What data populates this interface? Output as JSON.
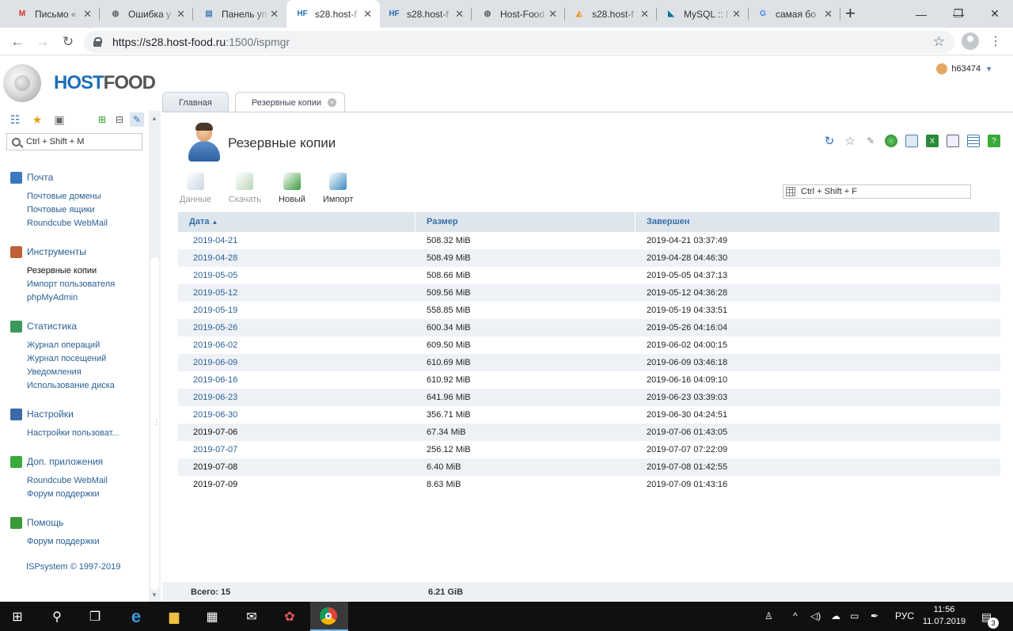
{
  "browser": {
    "tabs": [
      {
        "title": "Письмо «",
        "favicon": "gmail-icon",
        "color": "#d93025",
        "glyph": "M"
      },
      {
        "title": "Ошибка у",
        "favicon": "globe-icon",
        "color": "#5f6368",
        "glyph": "◍"
      },
      {
        "title": "Панель уп",
        "favicon": "document-icon",
        "color": "#4a7fb5",
        "glyph": "▤"
      },
      {
        "title": "s28.host-f",
        "favicon": "hostfood-icon",
        "color": "#1d6fb8",
        "glyph": "HF",
        "active": true
      },
      {
        "title": "s28.host-f",
        "favicon": "hostfood-icon",
        "color": "#1d6fb8",
        "glyph": "HF"
      },
      {
        "title": "Host-Food",
        "favicon": "globe-icon",
        "color": "#5f6368",
        "glyph": "◍"
      },
      {
        "title": "s28.host-f",
        "favicon": "phpmyadmin-icon",
        "color": "#f29111",
        "glyph": "◭"
      },
      {
        "title": "MySQL :: I",
        "favicon": "mysql-icon",
        "color": "#00758f",
        "glyph": "◣"
      },
      {
        "title": "самая бо",
        "favicon": "google-icon",
        "color": "#4285f4",
        "glyph": "G"
      }
    ],
    "url_host": "https://s28.host-food.ru",
    "url_path": ":1500/ispmgr"
  },
  "app": {
    "logo_a": "HOST",
    "logo_b": "FOOD",
    "user": "h63474",
    "tabs": [
      {
        "label": "Главная"
      },
      {
        "label": "Резервные копии"
      }
    ]
  },
  "sidebar": {
    "search_placeholder": "Ctrl + Shift + M",
    "sections": [
      {
        "title": "Почта",
        "icon_color": "#3a78c0",
        "items": [
          "Почтовые домены",
          "Почтовые ящики",
          "Roundcube WebMail"
        ]
      },
      {
        "title": "Инструменты",
        "icon_color": "#c0603a",
        "items": [
          "Резервные копии",
          "Импорт пользователя",
          "phpMyAdmin"
        ]
      },
      {
        "title": "Статистика",
        "icon_color": "#3a9a5a",
        "items": [
          "Журнал операций",
          "Журнал посещений",
          "Уведомления",
          "Использование диска"
        ]
      },
      {
        "title": "Настройки",
        "icon_color": "#3a6aa8",
        "items": [
          "Настройки пользоват..."
        ]
      },
      {
        "title": "Доп. приложения",
        "icon_color": "#3aaa3a",
        "items": [
          "Roundcube WebMail",
          "Форум поддержки"
        ]
      },
      {
        "title": "Помощь",
        "icon_color": "#3a9a3a",
        "items": [
          "Форум поддержки"
        ]
      }
    ],
    "copyright": "ISPsystem © 1997-2019"
  },
  "main": {
    "title": "Резервные копии",
    "actions": [
      {
        "label": "Данные",
        "disabled": true,
        "color": "#8aa4c4"
      },
      {
        "label": "Скачать",
        "disabled": true,
        "color": "#6aa06a"
      },
      {
        "label": "Новый",
        "disabled": false,
        "color": "#3a9a3a"
      },
      {
        "label": "Импорт",
        "disabled": false,
        "color": "#3a8ac0"
      }
    ],
    "table_search_placeholder": "Ctrl + Shift + F",
    "columns": [
      "Дата",
      "Размер",
      "Завершен"
    ],
    "rows": [
      {
        "date": "2019-04-21",
        "size": "508.32 MiB",
        "done": "2019-04-21 03:37:49",
        "link": true
      },
      {
        "date": "2019-04-28",
        "size": "508.49 MiB",
        "done": "2019-04-28 04:46:30",
        "link": true
      },
      {
        "date": "2019-05-05",
        "size": "508.66 MiB",
        "done": "2019-05-05 04:37:13",
        "link": true
      },
      {
        "date": "2019-05-12",
        "size": "509.56 MiB",
        "done": "2019-05-12 04:36:28",
        "link": true
      },
      {
        "date": "2019-05-19",
        "size": "558.85 MiB",
        "done": "2019-05-19 04:33:51",
        "link": true
      },
      {
        "date": "2019-05-26",
        "size": "600.34 MiB",
        "done": "2019-05-26 04:16:04",
        "link": true
      },
      {
        "date": "2019-06-02",
        "size": "609.50 MiB",
        "done": "2019-06-02 04:00:15",
        "link": true
      },
      {
        "date": "2019-06-09",
        "size": "610.69 MiB",
        "done": "2019-06-09 03:46:18",
        "link": true
      },
      {
        "date": "2019-06-16",
        "size": "610.92 MiB",
        "done": "2019-06-16 04:09:10",
        "link": true
      },
      {
        "date": "2019-06-23",
        "size": "641.96 MiB",
        "done": "2019-06-23 03:39:03",
        "link": true
      },
      {
        "date": "2019-06-30",
        "size": "356.71 MiB",
        "done": "2019-06-30 04:24:51",
        "link": true
      },
      {
        "date": "2019-07-06",
        "size": "67.34 MiB",
        "done": "2019-07-06 01:43:05",
        "link": false
      },
      {
        "date": "2019-07-07",
        "size": "256.12 MiB",
        "done": "2019-07-07 07:22:09",
        "link": true
      },
      {
        "date": "2019-07-08",
        "size": "6.40 MiB",
        "done": "2019-07-08 01:42:55",
        "link": false
      },
      {
        "date": "2019-07-09",
        "size": "8.63 MiB",
        "done": "2019-07-09 01:43:16",
        "link": false
      }
    ],
    "footer_total": "Всего: 15",
    "footer_size": "6.21 GiB"
  },
  "taskbar": {
    "lang": "РУС",
    "time": "11:56",
    "date": "11.07.2019",
    "notifications": "3"
  }
}
